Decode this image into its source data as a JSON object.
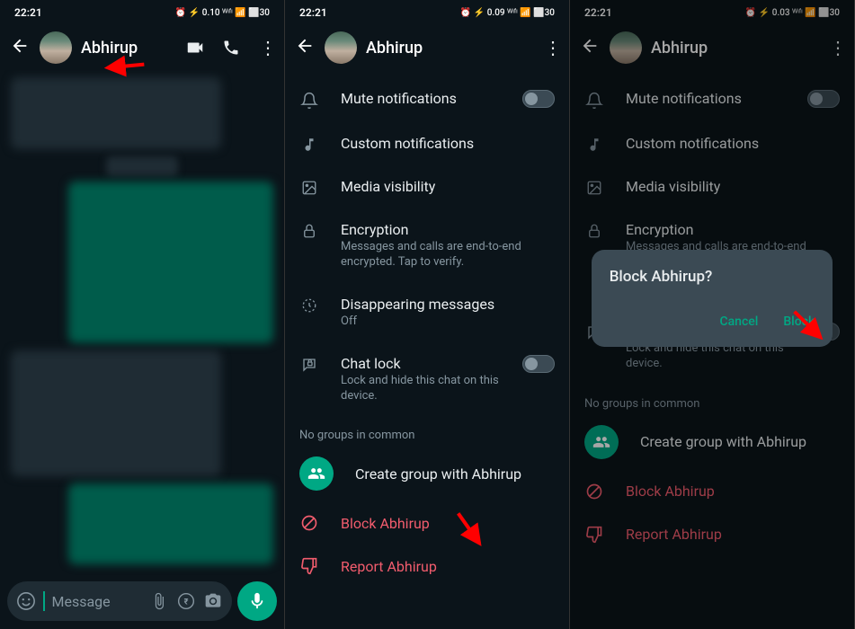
{
  "status": {
    "time": "22:21",
    "indicators": "⏰ ⚡ 0.10 ᵂᶦᶠᶦ 📶 ⬜30"
  },
  "contact": {
    "name": "Abhirup"
  },
  "input": {
    "placeholder": "Message"
  },
  "settings": {
    "mute": {
      "title": "Mute notifications"
    },
    "custom": {
      "title": "Custom notifications"
    },
    "media": {
      "title": "Media visibility"
    },
    "encryption": {
      "title": "Encryption",
      "sub": "Messages and calls are end-to-end encrypted. Tap to verify."
    },
    "disappearing": {
      "title": "Disappearing messages",
      "sub": "Off"
    },
    "chatlock": {
      "title": "Chat lock",
      "sub": "Lock and hide this chat on this device."
    },
    "no_groups": "No groups in common",
    "create_group": "Create group with Abhirup",
    "block": "Block Abhirup",
    "report": "Report Abhirup"
  },
  "dialog": {
    "title": "Block Abhirup?",
    "cancel": "Cancel",
    "confirm": "Block"
  },
  "status_alt": {
    "p2": "⏰ ⚡ 0.09 ᵂᶦᶠᶦ 📶 ⬜30",
    "p3": "⏰ ⚡ 0.03 ᵂᶦᶠᶦ 📶 ⬜30"
  }
}
